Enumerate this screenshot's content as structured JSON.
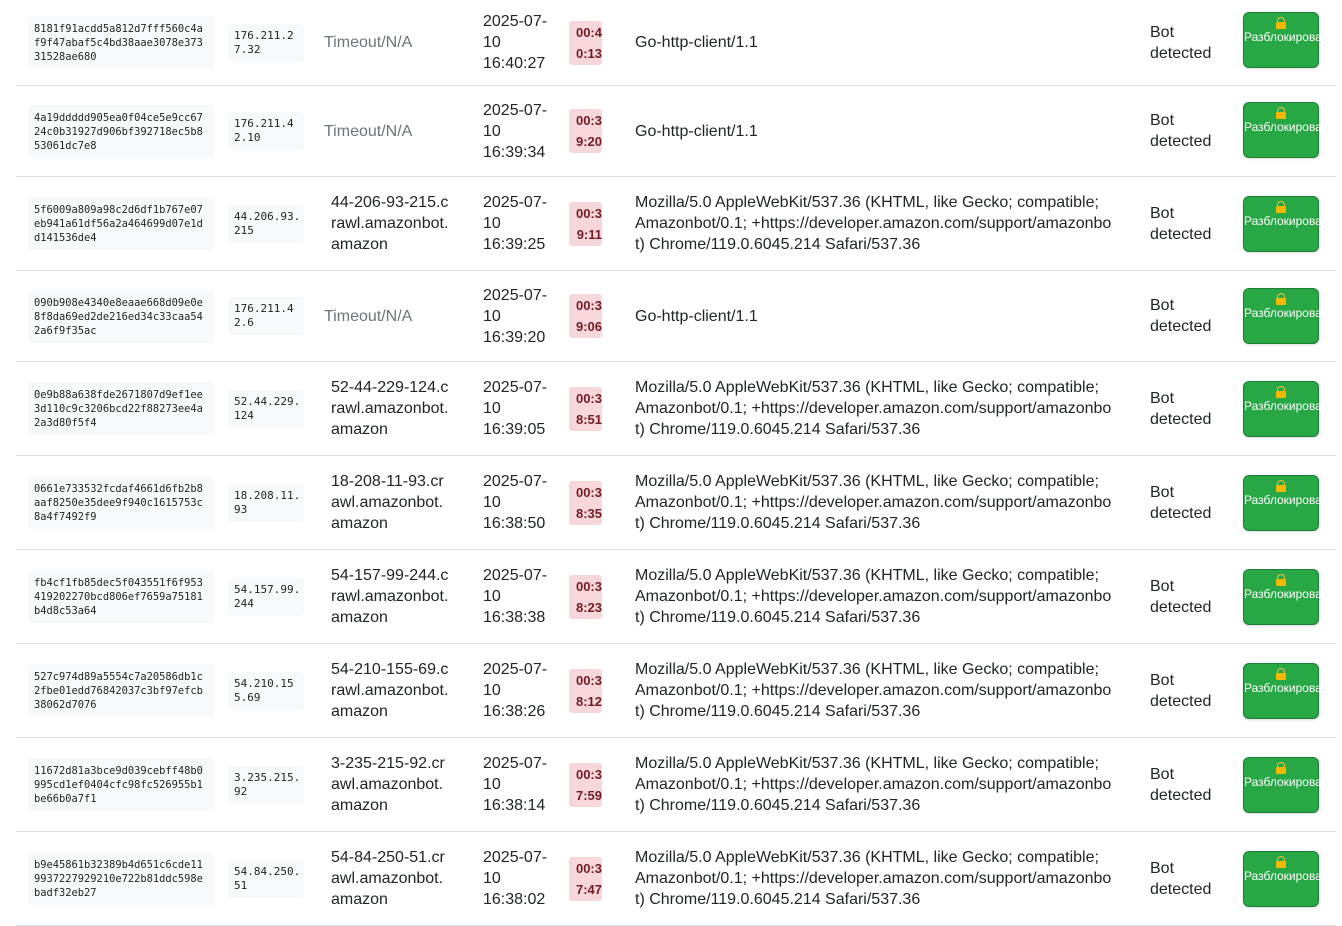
{
  "unlock_label": "Разблокировать",
  "colors": {
    "button": "#28a745",
    "duration_bg": "#f8d7da",
    "duration_text": "#721c24"
  },
  "rows": [
    {
      "hash": "8181f91acdd5a812d7fff560c4af9f47abaf5c4bd38aae3078e37331528ae680",
      "ip": "176.211.27.32",
      "host": "Timeout/N/A",
      "date": "2025-07-10 16:40:27",
      "duration": "00:40:13",
      "ua": "Go-http-client/1.1",
      "status": "Bot detected"
    },
    {
      "hash": "4a19ddddd905ea0f04ce5e9cc6724c0b31927d906bf392718ec5b853061dc7e8",
      "ip": "176.211.42.10",
      "host": "Timeout/N/A",
      "date": "2025-07-10 16:39:34",
      "duration": "00:39:20",
      "ua": "Go-http-client/1.1",
      "status": "Bot detected"
    },
    {
      "hash": "5f6009a809a98c2d6df1b767e07eb941a61df56a2a464699d07e1dd141536de4",
      "ip": "44.206.93.215",
      "host": "44-206-93-215.crawl.amazonbot.amazon",
      "date": "2025-07-10 16:39:25",
      "duration": "00:39:11",
      "ua": "Mozilla/5.0 AppleWebKit/537.36 (KHTML, like Gecko; compatible; Amazonbot/0.1; +https://developer.amazon.com/support/amazonbot) Chrome/119.0.6045.214 Safari/537.36",
      "status": "Bot detected"
    },
    {
      "hash": "090b908e4340e8eaae668d09e0e8f8da69ed2de216ed34c33caa542a6f9f35ac",
      "ip": "176.211.42.6",
      "host": "Timeout/N/A",
      "date": "2025-07-10 16:39:20",
      "duration": "00:39:06",
      "ua": "Go-http-client/1.1",
      "status": "Bot detected"
    },
    {
      "hash": "0e9b88a638fde2671807d9ef1ee3d110c9c3206bcd22f88273ee4a2a3d80f5f4",
      "ip": "52.44.229.124",
      "host": "52-44-229-124.crawl.amazonbot.amazon",
      "date": "2025-07-10 16:39:05",
      "duration": "00:38:51",
      "ua": "Mozilla/5.0 AppleWebKit/537.36 (KHTML, like Gecko; compatible; Amazonbot/0.1; +https://developer.amazon.com/support/amazonbot) Chrome/119.0.6045.214 Safari/537.36",
      "status": "Bot detected"
    },
    {
      "hash": "0661e733532fcdaf4661d6fb2b8aaf8250e35dee9f940c1615753c8a4f7492f9",
      "ip": "18.208.11.93",
      "host": "18-208-11-93.crawl.amazonbot.amazon",
      "date": "2025-07-10 16:38:50",
      "duration": "00:38:35",
      "ua": "Mozilla/5.0 AppleWebKit/537.36 (KHTML, like Gecko; compatible; Amazonbot/0.1; +https://developer.amazon.com/support/amazonbot) Chrome/119.0.6045.214 Safari/537.36",
      "status": "Bot detected"
    },
    {
      "hash": "fb4cf1fb85dec5f043551f6f953419202270bcd806ef7659a75181b4d8c53a64",
      "ip": "54.157.99.244",
      "host": "54-157-99-244.crawl.amazonbot.amazon",
      "date": "2025-07-10 16:38:38",
      "duration": "00:38:23",
      "ua": "Mozilla/5.0 AppleWebKit/537.36 (KHTML, like Gecko; compatible; Amazonbot/0.1; +https://developer.amazon.com/support/amazonbot) Chrome/119.0.6045.214 Safari/537.36",
      "status": "Bot detected"
    },
    {
      "hash": "527c974d89a5554c7a20586db1c2fbe01edd76842037c3bf97efcb38062d7076",
      "ip": "54.210.155.69",
      "host": "54-210-155-69.crawl.amazonbot.amazon",
      "date": "2025-07-10 16:38:26",
      "duration": "00:38:12",
      "ua": "Mozilla/5.0 AppleWebKit/537.36 (KHTML, like Gecko; compatible; Amazonbot/0.1; +https://developer.amazon.com/support/amazonbot) Chrome/119.0.6045.214 Safari/537.36",
      "status": "Bot detected"
    },
    {
      "hash": "11672d81a3bce9d039cebff48b0995cd1ef0404cfc98fc526955b1be66b0a7f1",
      "ip": "3.235.215.92",
      "host": "3-235-215-92.crawl.amazonbot.amazon",
      "date": "2025-07-10 16:38:14",
      "duration": "00:37:59",
      "ua": "Mozilla/5.0 AppleWebKit/537.36 (KHTML, like Gecko; compatible; Amazonbot/0.1; +https://developer.amazon.com/support/amazonbot) Chrome/119.0.6045.214 Safari/537.36",
      "status": "Bot detected"
    },
    {
      "hash": "b9e45861b32389b4d651c6cde119937227929210e722b81ddc598ebadf32eb27",
      "ip": "54.84.250.51",
      "host": "54-84-250-51.crawl.amazonbot.amazon",
      "date": "2025-07-10 16:38:02",
      "duration": "00:37:47",
      "ua": "Mozilla/5.0 AppleWebKit/537.36 (KHTML, like Gecko; compatible; Amazonbot/0.1; +https://developer.amazon.com/support/amazonbot) Chrome/119.0.6045.214 Safari/537.36",
      "status": "Bot detected"
    }
  ]
}
